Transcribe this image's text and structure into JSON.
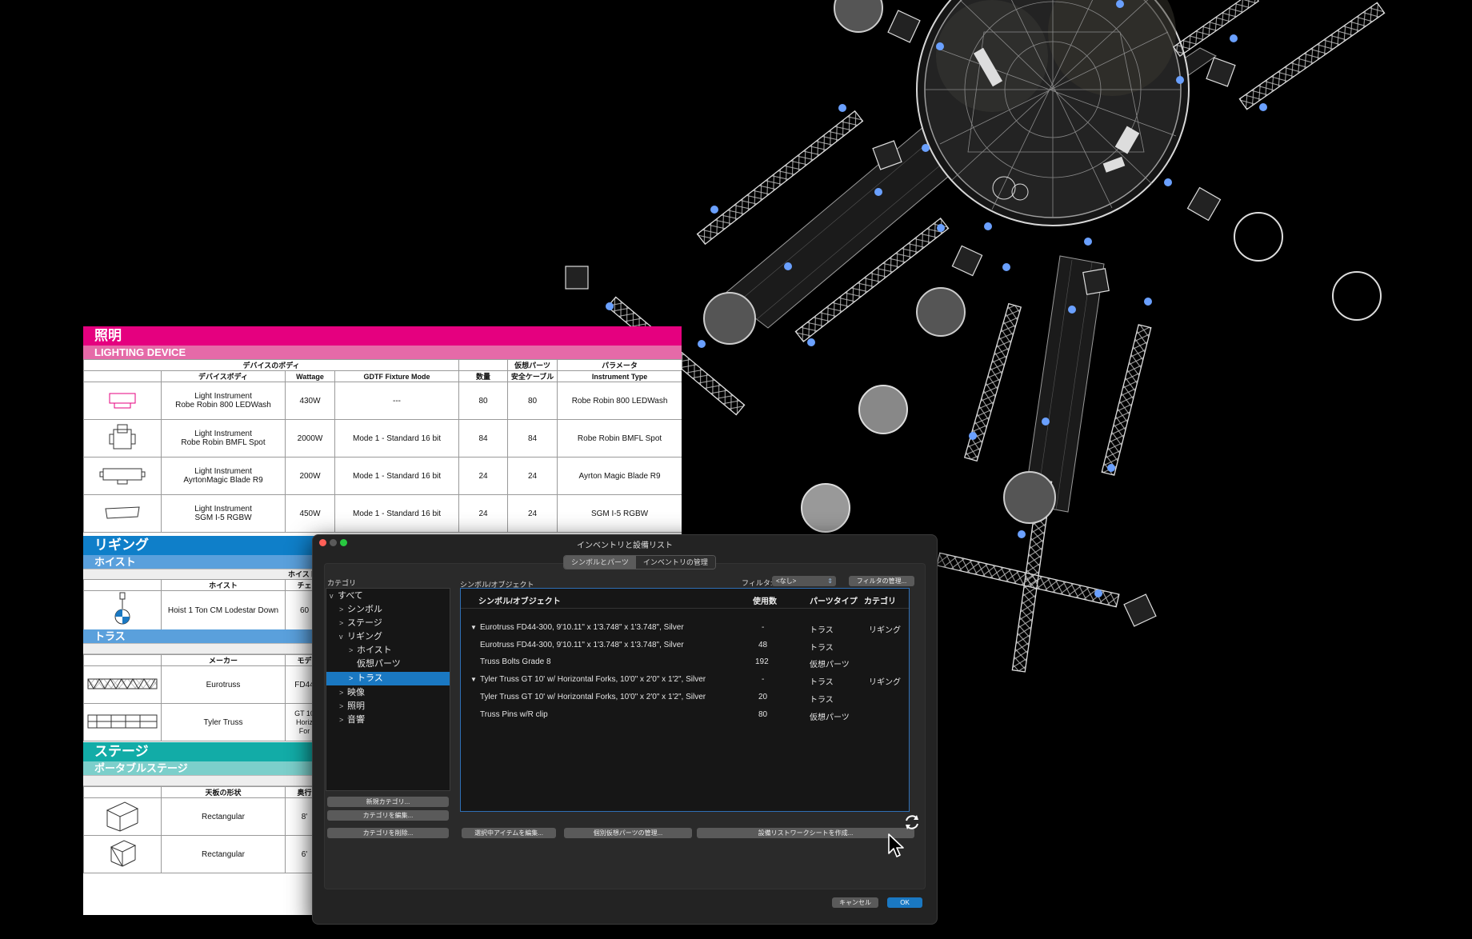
{
  "lighting": {
    "title_ja": "照明",
    "title_en": "LIGHTING DEVICE",
    "header_groups": [
      "デバイスのボディ",
      "仮想パーツ",
      "パラメータ"
    ],
    "columns": [
      "デバイスボディ",
      "Wattage",
      "GDTF Fixture Mode",
      "数量",
      "安全ケーブル",
      "Instrument Type"
    ],
    "rows": [
      {
        "name1": "Light Instrument",
        "name2": "Robe Robin 800 LEDWash",
        "wattage": "430W",
        "mode": "---",
        "qty": "80",
        "safety": "80",
        "type": "Robe Robin 800 LEDWash"
      },
      {
        "name1": "Light Instrument",
        "name2": "Robe Robin BMFL Spot",
        "wattage": "2000W",
        "mode": "Mode 1 - Standard 16 bit",
        "qty": "84",
        "safety": "84",
        "type": "Robe Robin BMFL Spot"
      },
      {
        "name1": "Light Instrument",
        "name2": "AyrtonMagic Blade R9",
        "wattage": "200W",
        "mode": "Mode 1 - Standard 16 bit",
        "qty": "24",
        "safety": "24",
        "type": "Ayrton Magic Blade R9"
      },
      {
        "name1": "Light Instrument",
        "name2": "SGM I-5 RGBW",
        "wattage": "450W",
        "mode": "Mode 1 - Standard 16 bit",
        "qty": "24",
        "safety": "24",
        "type": "SGM I-5 RGBW"
      }
    ]
  },
  "rigging": {
    "title": "リギング",
    "hoist_title": "ホイスト",
    "hoist_group": "ホイスト",
    "hoist_columns": [
      "ホイスト",
      "チェ"
    ],
    "hoist_row": {
      "name": "Hoist 1 Ton CM Lodestar Down",
      "value": "60"
    },
    "truss_title": "トラス",
    "truss_columns": [
      "メーカー",
      "モデ"
    ],
    "truss_rows": [
      {
        "maker": "Eurotruss",
        "model1": "FD44",
        "model2": "",
        "model3": ""
      },
      {
        "maker": "Tyler Truss",
        "model1": "GT 10",
        "model2": "Horiz",
        "model3": "For"
      }
    ]
  },
  "stage": {
    "title": "ステージ",
    "sub_title": "ポータブルステージ",
    "columns": [
      "天板の形状",
      "奥行"
    ],
    "rows": [
      {
        "shape": "Rectangular",
        "depth": "8'"
      },
      {
        "shape": "Rectangular",
        "depth": "6'"
      }
    ]
  },
  "dialog": {
    "title": "インベントリと設備リスト",
    "tabs": [
      "シンボルとパーツ",
      "インベントリの管理"
    ],
    "category_label": "カテゴリ",
    "categories": [
      {
        "label": "すべて",
        "chevron": "v"
      },
      {
        "label": "シンボル",
        "chevron": ">"
      },
      {
        "label": "ステージ",
        "chevron": ">"
      },
      {
        "label": "リギング",
        "chevron": "v"
      },
      {
        "label": "ホイスト",
        "chevron": ">"
      },
      {
        "label": "仮想パーツ",
        "chevron": ""
      },
      {
        "label": "トラス",
        "chevron": ">"
      },
      {
        "label": "映像",
        "chevron": ">"
      },
      {
        "label": "照明",
        "chevron": ">"
      },
      {
        "label": "音響",
        "chevron": ">"
      }
    ],
    "selected_category": "トラス",
    "category_buttons": [
      "新規カテゴリ...",
      "カテゴリを編集...",
      "カテゴリを削除..."
    ],
    "objects_label": "シンボル/オブジェクト",
    "filter_label": "フィルタ:",
    "filter_value": "<なし>",
    "filter_manage_button": "フィルタの管理...",
    "columns": [
      "シンボル/オブジェクト",
      "使用数",
      "パーツタイプ",
      "カテゴリ"
    ],
    "rows": [
      {
        "arrow": "▼",
        "name": "Eurotruss FD44-300, 9'10.11\" x 1'3.748\" x 1'3.748\", Silver",
        "count": "-",
        "type": "トラス",
        "category": "リギング"
      },
      {
        "arrow": "",
        "name": "Eurotruss FD44-300, 9'10.11\" x 1'3.748\" x 1'3.748\", Silver",
        "count": "48",
        "type": "トラス",
        "category": ""
      },
      {
        "arrow": "",
        "name": "Truss Bolts Grade 8",
        "count": "192",
        "type": "仮想パーツ",
        "category": ""
      },
      {
        "arrow": "▼",
        "name": "Tyler Truss GT 10' w/ Horizontal Forks, 10'0\" x 2'0\" x 1'2\", Silver",
        "count": "-",
        "type": "トラス",
        "category": "リギング"
      },
      {
        "arrow": "",
        "name": "Tyler Truss GT 10' w/ Horizontal Forks, 10'0\" x 2'0\" x 1'2\", Silver",
        "count": "20",
        "type": "トラス",
        "category": ""
      },
      {
        "arrow": "",
        "name": "Truss Pins w/R clip",
        "count": "80",
        "type": "仮想パーツ",
        "category": ""
      }
    ],
    "action_buttons": [
      "選択中アイテムを編集...",
      "個別仮想パーツの管理...",
      "設備リストワークシートを作成..."
    ],
    "cancel_label": "キャンセル",
    "ok_label": "OK",
    "colors": {
      "accent": "#1a78c2",
      "lighting": "#e5007f",
      "rigging": "#0f7fc9",
      "stage": "#12aca7"
    }
  }
}
